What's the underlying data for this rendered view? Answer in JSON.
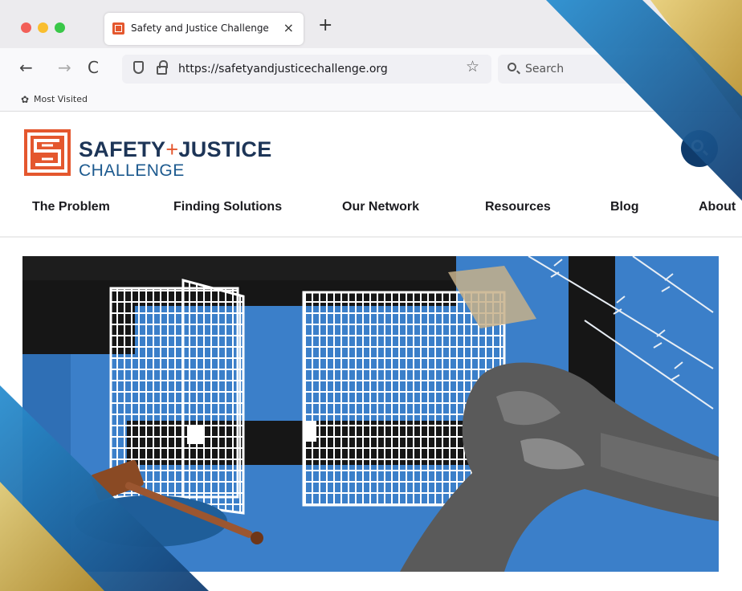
{
  "browser": {
    "tab": {
      "title": "Safety and Justice Challenge",
      "close_glyph": "×"
    },
    "new_tab_glyph": "+",
    "nav": {
      "back": "←",
      "forward": "→",
      "reload": "C"
    },
    "url": "https://safetyandjusticechallenge.org",
    "bookmark_star": "☆",
    "search_placeholder": "Search",
    "bookmarks": {
      "most_visited": "Most Visited"
    }
  },
  "site": {
    "logo": {
      "line1_a": "SAFETY",
      "plus": "+",
      "line1_b": "JUSTICE",
      "line2": "CHALLENGE"
    },
    "nav": [
      "The Problem",
      "Finding Solutions",
      "Our Network",
      "Resources",
      "Blog",
      "About"
    ]
  },
  "colors": {
    "brand_orange": "#e4572e",
    "brand_navy": "#1d3557",
    "search_button": "#0f3b6b",
    "hero_blue": "#3b7fc9",
    "ribbon_gold": "#c9a24a",
    "ribbon_blue": "#1f6fb2"
  }
}
